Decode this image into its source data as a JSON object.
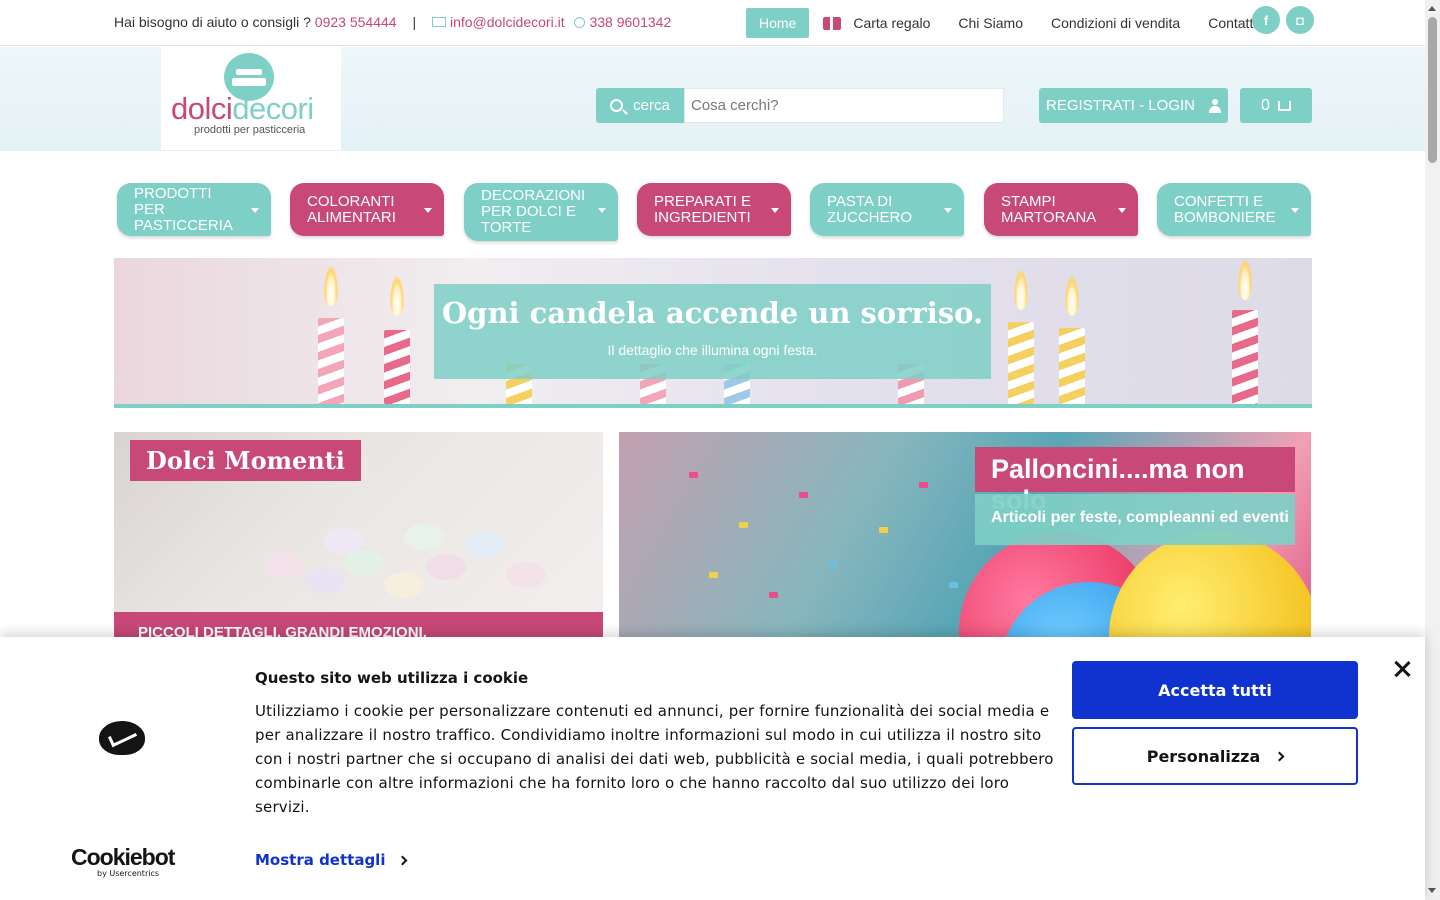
{
  "topbar": {
    "help_text": "Hai bisogno di aiuto o consigli ?",
    "phone": "0923 554444",
    "separator": "|",
    "email": "info@dolcidecori.it",
    "mobile": "338 9601342",
    "nav": {
      "home": "Home",
      "gift_card": "Carta regalo",
      "about": "Chi Siamo",
      "terms": "Condizioni di vendita",
      "contacts": "Contatti"
    },
    "social": {
      "facebook": "f",
      "instagram": "◘"
    }
  },
  "header": {
    "logo": {
      "word_a": "dolci",
      "word_b": "decori",
      "tagline": "prodotti per pasticceria"
    },
    "search": {
      "button_label": "cerca",
      "placeholder": "Cosa cerchi?"
    },
    "login_label": "REGISTRATI - LOGIN",
    "cart_count": "0"
  },
  "categories": [
    {
      "label": "PRODOTTI PER PASTICCERIA",
      "color": "teal"
    },
    {
      "label": "COLORANTI ALIMENTARI",
      "color": "pink"
    },
    {
      "label": "DECORAZIONI PER DOLCI E TORTE",
      "color": "teal"
    },
    {
      "label": "PREPARATI E INGREDIENTI",
      "color": "pink"
    },
    {
      "label": "PASTA DI ZUCCHERO",
      "color": "teal"
    },
    {
      "label": "STAMPI MARTORANA",
      "color": "pink"
    },
    {
      "label": "CONFETTI E BOMBONIERE",
      "color": "teal"
    }
  ],
  "banner": {
    "title": "Ogni candela accende un sorriso.",
    "subtitle": "Il dettaglio che illumina ogni festa."
  },
  "tiles": {
    "dolci": {
      "title": "Dolci Momenti",
      "strip": "PICCOLI DETTAGLI, GRANDI EMOZIONI."
    },
    "palloncini": {
      "title": "Palloncini....ma non solo",
      "subtitle": "Articoli per feste, compleanni ed eventi"
    }
  },
  "cookie": {
    "title": "Questo sito web utilizza i cookie",
    "body": "Utilizziamo i cookie per personalizzare contenuti ed annunci, per fornire funzionalità dei social media e per analizzare il nostro traffico. Condividiamo inoltre informazioni sul modo in cui utilizza il nostro sito con i nostri partner che si occupano di analisi dei dati web, pubblicità e social media, i quali potrebbero combinarle con altre informazioni che ha fornito loro o che hanno raccolto dal suo utilizzo dei loro servizi.",
    "details": "Mostra dettagli",
    "accept": "Accetta tutti",
    "customize": "Personalizza",
    "brand": "Cookiebot",
    "brand_sub": "by Usercentrics"
  },
  "colors": {
    "teal": "#7ecfc5",
    "pink": "#c84878",
    "cookie_blue": "#1032cf"
  },
  "icons": [
    "envelope-icon",
    "whatsapp-icon",
    "gift-card-icon",
    "facebook-icon",
    "instagram-icon",
    "search-icon",
    "user-icon",
    "cart-icon",
    "caret-down-icon",
    "close-icon",
    "chevron-right-icon",
    "cookiebot-logo-icon"
  ]
}
